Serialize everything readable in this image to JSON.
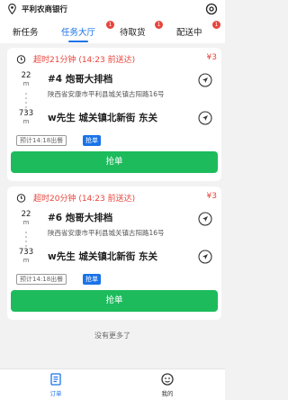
{
  "header": {
    "shop_name": "平利农商银行"
  },
  "tabs": [
    {
      "label": "新任务",
      "badge": null
    },
    {
      "label": "任务大厅",
      "badge": "1"
    },
    {
      "label": "待取货",
      "badge": "1"
    },
    {
      "label": "配送中",
      "badge": "1"
    }
  ],
  "orders": [
    {
      "timeout": "超时21分钟 (14:23 前送达)",
      "price": "¥3",
      "pickup_distance": "22",
      "pickup_unit": "m",
      "delivery_distance": "733",
      "delivery_unit": "m",
      "shop": "#4 炮哥大排档",
      "shop_address": "陕西省安康市平利县城关镇古阳路16号",
      "customer": "w先生 城关镇北新街 东关",
      "eta_tag": "预计14:18出餐",
      "grab_tag": "抢单",
      "button": "抢单"
    },
    {
      "timeout": "超时20分钟 (14:23 前送达)",
      "price": "¥3",
      "pickup_distance": "22",
      "pickup_unit": "m",
      "delivery_distance": "733",
      "delivery_unit": "m",
      "shop": "#6 炮哥大排档",
      "shop_address": "陕西省安康市平利县城关镇古阳路16号",
      "customer": "w先生 城关镇北新街 东关",
      "eta_tag": "预计14:18出餐",
      "grab_tag": "抢单",
      "button": "抢单"
    }
  ],
  "footer_text": "没有更多了",
  "bottom_nav": [
    {
      "label": "订单",
      "icon": "order-icon",
      "active": true
    },
    {
      "label": "我的",
      "icon": "profile-icon",
      "active": false
    }
  ],
  "colors": {
    "accent": "#1a73e8",
    "danger": "#e8453c",
    "grab_button": "#1dbb5c"
  }
}
